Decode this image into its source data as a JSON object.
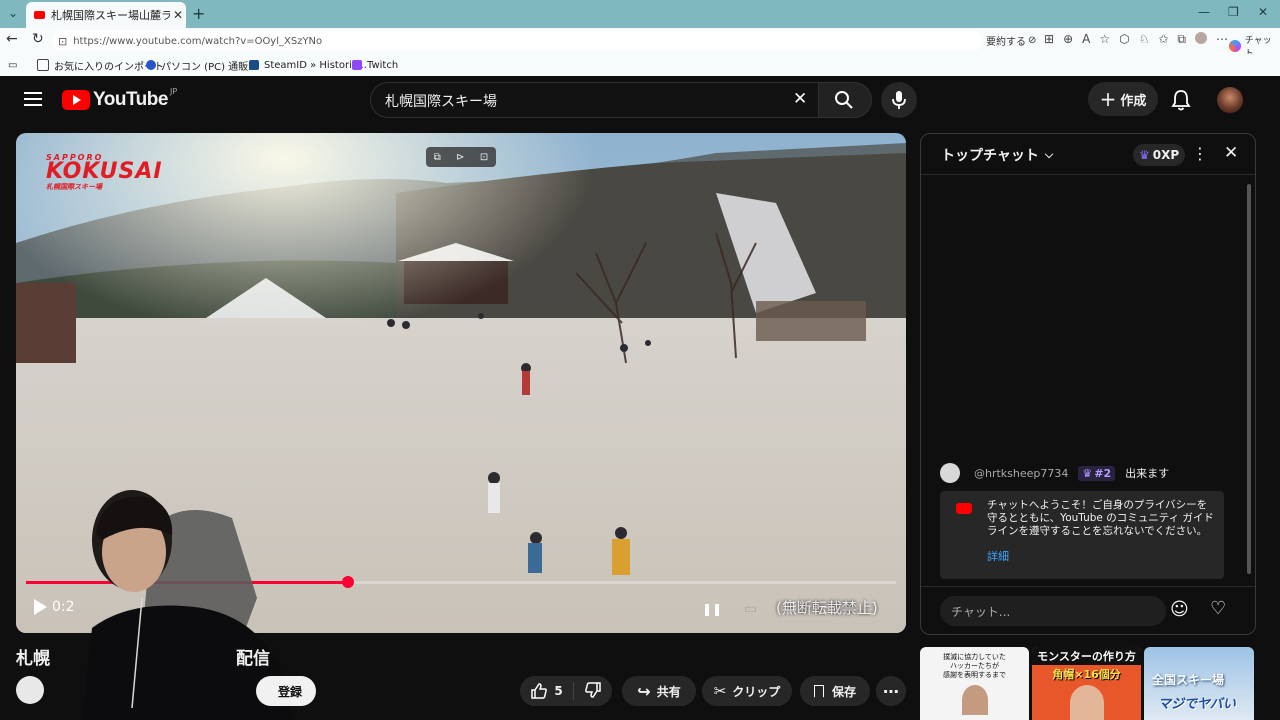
{
  "browser": {
    "tab_title": "札幌国際スキー場山麓ライブ配信 - Yo",
    "url": "https://www.youtube.com/watch?v=OOyl_XSzYNo",
    "summarize_label": "要約する",
    "copilot_label": "チャット",
    "bookmarks": [
      "お気に入りのインポート",
      "パソコン (PC) 通販...",
      "SteamID » Historic...",
      "Twitch"
    ]
  },
  "youtube": {
    "logo_text": "YouTube",
    "region": "JP",
    "search_value": "札幌国際スキー場",
    "create_label": "作成"
  },
  "video": {
    "overlay_logo_top": "SAPPORO",
    "overlay_logo_main": "KOKUSAI",
    "overlay_logo_sub": "札幌国際スキー場",
    "time_partial": "0:2",
    "notice": "(無断転載禁止)",
    "progress_fraction": 0.37,
    "title_visible_start": "札幌",
    "title_visible_end": "配信",
    "subscribe_label": "登録"
  },
  "actions": {
    "like_count": "5",
    "share": "共有",
    "clip": "クリップ",
    "save": "保存"
  },
  "chat": {
    "header": "トップチャット",
    "xp": "0XP",
    "message": {
      "author": "@hrtksheep7734",
      "rank": "#2",
      "text": "出来ます"
    },
    "welcome_text": "チャットへようこそ！ご自身のプライバシーを守るとともに、YouTube のコミュニティ ガイドラインを遵守することを忘れないでください。",
    "welcome_link": "詳細",
    "input_placeholder": "チャット..."
  },
  "recommendations": [
    {
      "line1": "撲滅に協力していた",
      "line2": "ハッカーたちが",
      "line3": "感謝を表明するまで"
    },
    {
      "line1": "モンスターの作り方",
      "line2": "角帽×16個分"
    },
    {
      "line1": "全国スキー場",
      "line2": "マジでヤバい"
    }
  ],
  "colors": {
    "accent_red": "#ff0033",
    "yt_red": "#ff0000",
    "link_blue": "#3ea6ff",
    "membership_purple": "#6d4aff"
  }
}
